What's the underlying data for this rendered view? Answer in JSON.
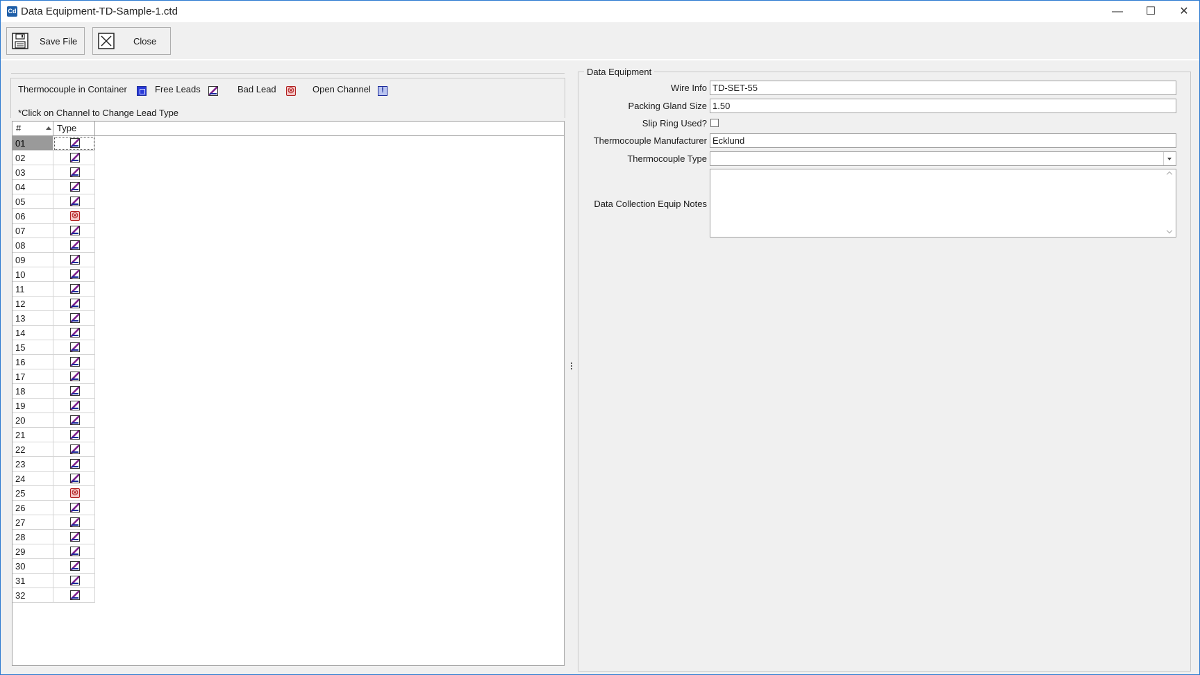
{
  "window": {
    "title": "Data Equipment-TD-Sample-1.ctd",
    "app_icon": "Cd"
  },
  "toolbar": {
    "save_label": "Save File",
    "close_label": "Close"
  },
  "legend": {
    "tc_in_container": "Thermocouple in Container",
    "free_leads": "Free Leads",
    "bad_lead": "Bad Lead",
    "open_channel": "Open Channel",
    "note": "*Click on Channel to Change Lead Type"
  },
  "grid": {
    "columns": [
      "#",
      "Type"
    ],
    "selected_channel": "01",
    "rows": [
      {
        "channel": "01",
        "type": "free"
      },
      {
        "channel": "02",
        "type": "free"
      },
      {
        "channel": "03",
        "type": "free"
      },
      {
        "channel": "04",
        "type": "free"
      },
      {
        "channel": "05",
        "type": "free"
      },
      {
        "channel": "06",
        "type": "bad"
      },
      {
        "channel": "07",
        "type": "free"
      },
      {
        "channel": "08",
        "type": "free"
      },
      {
        "channel": "09",
        "type": "free"
      },
      {
        "channel": "10",
        "type": "free"
      },
      {
        "channel": "11",
        "type": "free"
      },
      {
        "channel": "12",
        "type": "free"
      },
      {
        "channel": "13",
        "type": "free"
      },
      {
        "channel": "14",
        "type": "free"
      },
      {
        "channel": "15",
        "type": "free"
      },
      {
        "channel": "16",
        "type": "free"
      },
      {
        "channel": "17",
        "type": "free"
      },
      {
        "channel": "18",
        "type": "free"
      },
      {
        "channel": "19",
        "type": "free"
      },
      {
        "channel": "20",
        "type": "free"
      },
      {
        "channel": "21",
        "type": "free"
      },
      {
        "channel": "22",
        "type": "free"
      },
      {
        "channel": "23",
        "type": "free"
      },
      {
        "channel": "24",
        "type": "free"
      },
      {
        "channel": "25",
        "type": "bad"
      },
      {
        "channel": "26",
        "type": "free"
      },
      {
        "channel": "27",
        "type": "free"
      },
      {
        "channel": "28",
        "type": "free"
      },
      {
        "channel": "29",
        "type": "free"
      },
      {
        "channel": "30",
        "type": "free"
      },
      {
        "channel": "31",
        "type": "free"
      },
      {
        "channel": "32",
        "type": "free"
      }
    ]
  },
  "equipment": {
    "group_title": "Data Equipment",
    "wire_info_label": "Wire Info",
    "wire_info_value": "TD-SET-55",
    "packing_gland_label": "Packing Gland Size",
    "packing_gland_value": "1.50",
    "slip_ring_label": "Slip Ring Used?",
    "slip_ring_checked": false,
    "tc_manufacturer_label": "Thermocouple Manufacturer",
    "tc_manufacturer_value": "Ecklund",
    "tc_type_label": "Thermocouple Type",
    "tc_type_value": "",
    "notes_label": "Data Collection Equip Notes",
    "notes_value": ""
  }
}
